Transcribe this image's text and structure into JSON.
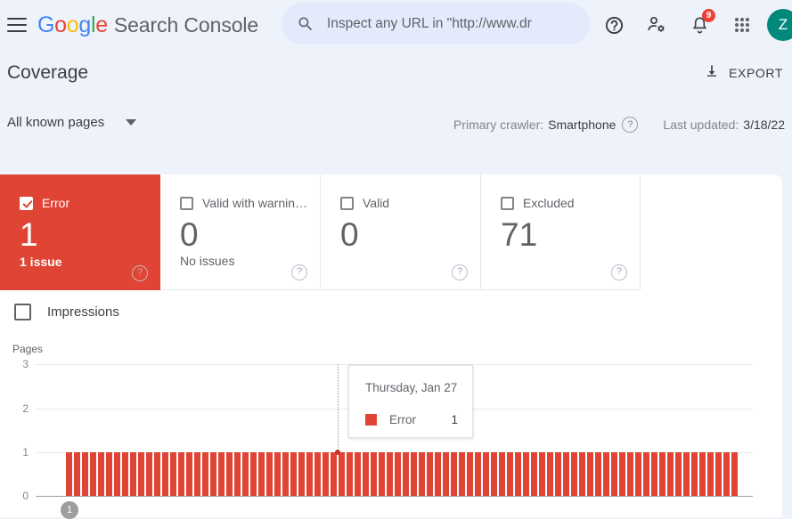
{
  "topbar": {
    "menu_icon": "hamburger-menu-icon",
    "logo_text": "Google",
    "product_name": "Search Console",
    "search": {
      "icon": "search-icon",
      "placeholder": "Inspect any URL in \"http://www.dr"
    },
    "help_icon": "help-circle-icon",
    "account_settings_icon": "person-settings-icon",
    "notifications_icon": "bell-icon",
    "notifications_badge": "9",
    "apps_icon": "apps-grid-icon",
    "avatar_initial": "Z"
  },
  "header": {
    "title": "Coverage",
    "export_icon": "download-icon",
    "export_label": "EXPORT"
  },
  "filters": {
    "page_scope": "All known pages",
    "dropdown_icon": "chevron-down-icon",
    "primary_crawler_label": "Primary crawler:",
    "primary_crawler_value": "Smartphone",
    "crawler_help_icon": "help-circle-icon",
    "last_updated_label": "Last updated:",
    "last_updated_value": "3/18/22"
  },
  "status_cards": [
    {
      "label": "Error",
      "value": "1",
      "sub": "1 issue",
      "checked": true,
      "selected": true,
      "color": "#e04434",
      "help_icon": "help-circle-icon"
    },
    {
      "label": "Valid with warnin…",
      "value": "0",
      "sub": "No issues",
      "checked": false,
      "selected": false,
      "color": "#fbbc05",
      "help_icon": "help-circle-icon"
    },
    {
      "label": "Valid",
      "value": "0",
      "sub": "",
      "checked": false,
      "selected": false,
      "color": "#34a853",
      "help_icon": "help-circle-icon"
    },
    {
      "label": "Excluded",
      "value": "71",
      "sub": "",
      "checked": false,
      "selected": false,
      "color": "#9aa0a6",
      "help_icon": "help-circle-icon"
    }
  ],
  "chart_controls": {
    "impressions_label": "Impressions",
    "impressions_checked": false
  },
  "tooltip": {
    "date": "Thursday, Jan 27",
    "series_name": "Error",
    "series_value": "1",
    "series_color": "#e04434"
  },
  "annotation": {
    "marker_label": "1"
  },
  "chart_data": {
    "type": "bar",
    "title": "",
    "xlabel": "",
    "ylabel": "Pages",
    "ylim": [
      0,
      3
    ],
    "yticks": [
      "0",
      "1",
      "2",
      "3"
    ],
    "grid": true,
    "legend": "none",
    "series": [
      {
        "name": "Error",
        "color": "#e04434",
        "values": [
          1,
          1,
          1,
          1,
          1,
          1,
          1,
          1,
          1,
          1,
          1,
          1,
          1,
          1,
          1,
          1,
          1,
          1,
          1,
          1,
          1,
          1,
          1,
          1,
          1,
          1,
          1,
          1,
          1,
          1,
          1,
          1,
          1,
          1,
          1,
          1,
          1,
          1,
          1,
          1,
          1,
          1,
          1,
          1,
          1,
          1,
          1,
          1,
          1,
          1,
          1,
          1,
          1,
          1,
          1,
          1,
          1,
          1,
          1,
          1,
          1,
          1,
          1,
          1,
          1,
          1,
          1,
          1,
          1,
          1,
          1,
          1,
          1,
          1,
          1,
          1,
          1,
          1,
          1,
          1,
          1,
          1,
          1,
          1
        ]
      }
    ],
    "highlighted_index": 34,
    "highlighted_label": "Thursday, Jan 27",
    "highlighted_value": 1
  }
}
